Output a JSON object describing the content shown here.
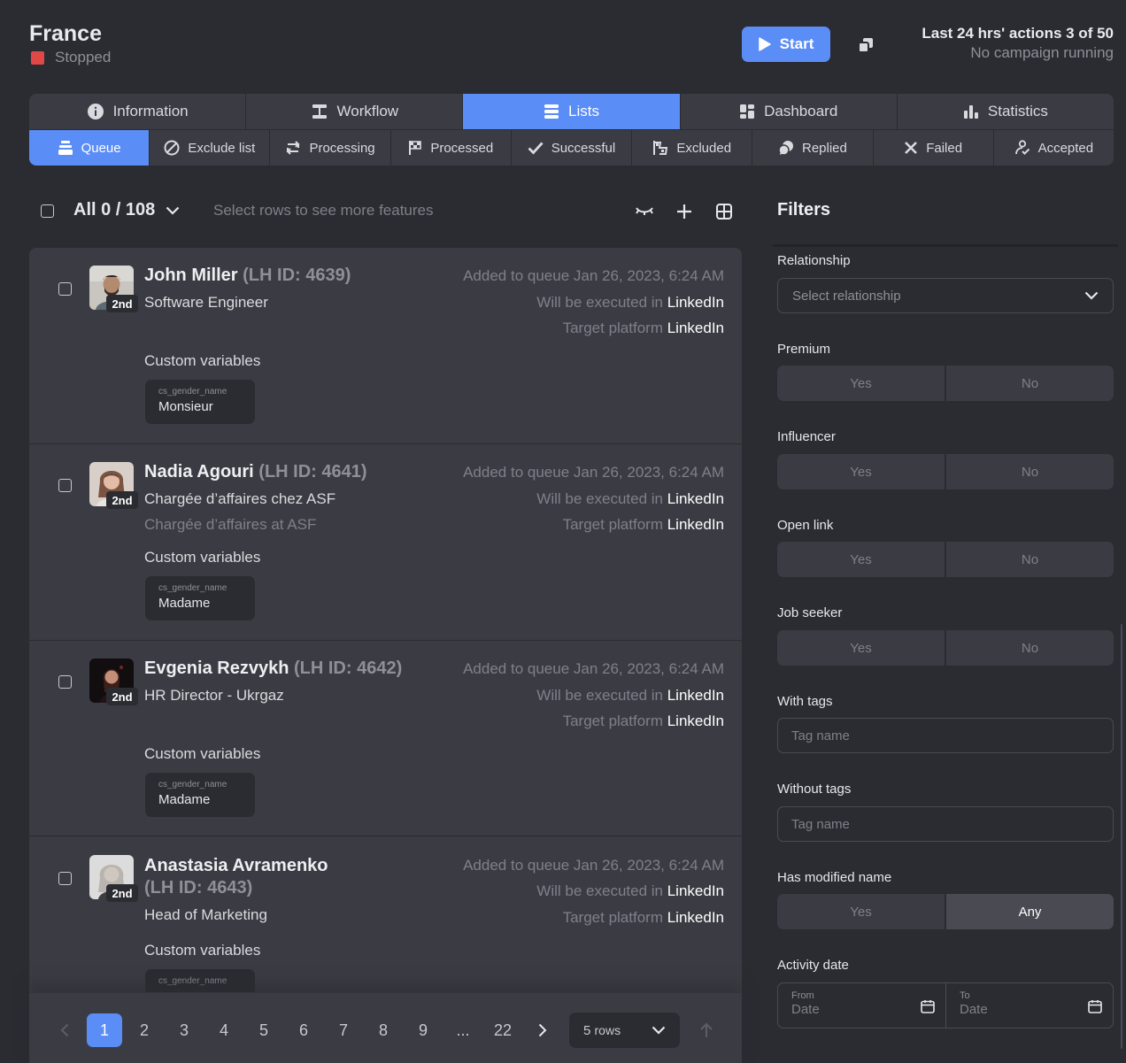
{
  "header": {
    "title": "France",
    "status": "Stopped",
    "start_label": "Start",
    "actions_line": "Last 24 hrs' actions 3 of 50",
    "campaign_line": "No campaign running"
  },
  "main_tabs": [
    {
      "label": "Information"
    },
    {
      "label": "Workflow"
    },
    {
      "label": "Lists"
    },
    {
      "label": "Dashboard"
    },
    {
      "label": "Statistics"
    }
  ],
  "sub_tabs": [
    {
      "label": "Queue"
    },
    {
      "label": "Exclude list"
    },
    {
      "label": "Processing"
    },
    {
      "label": "Processed"
    },
    {
      "label": "Successful"
    },
    {
      "label": "Excluded"
    },
    {
      "label": "Replied"
    },
    {
      "label": "Failed"
    },
    {
      "label": "Accepted"
    }
  ],
  "toolbar": {
    "all_count": "All 0 / 108",
    "hint": "Select rows to see more features"
  },
  "items": [
    {
      "name": "John Miller",
      "lh_id": "(LH ID: 4639)",
      "degree": "2nd",
      "headline": "Software Engineer",
      "headline_translated": "",
      "added": "Added to queue Jan 26, 2023, 6:24 AM",
      "executed_label": "Will be executed in",
      "executed_value": "LinkedIn",
      "platform_label": "Target platform",
      "platform_value": "LinkedIn",
      "cv_label": "Custom variables",
      "cv_key": "cs_gender_name",
      "cv_value": "Monsieur"
    },
    {
      "name": "Nadia Agouri",
      "lh_id": "(LH ID: 4641)",
      "degree": "2nd",
      "headline": "Chargée d’affaires chez ASF",
      "headline_translated": "Chargée d’affaires at ASF",
      "added": "Added to queue Jan 26, 2023, 6:24 AM",
      "executed_label": "Will be executed in",
      "executed_value": "LinkedIn",
      "platform_label": "Target platform",
      "platform_value": "LinkedIn",
      "cv_label": "Custom variables",
      "cv_key": "cs_gender_name",
      "cv_value": "Madame"
    },
    {
      "name": "Evgenia Rezvykh",
      "lh_id": "(LH ID: 4642)",
      "degree": "2nd",
      "headline": "HR Director - Ukrgaz",
      "headline_translated": "",
      "added": "Added to queue Jan 26, 2023, 6:24 AM",
      "executed_label": "Will be executed in",
      "executed_value": "LinkedIn",
      "platform_label": "Target platform",
      "platform_value": "LinkedIn",
      "cv_label": "Custom variables",
      "cv_key": "cs_gender_name",
      "cv_value": "Madame"
    },
    {
      "name": "Anastasia Avramenko",
      "lh_id": "(LH ID: 4643)",
      "degree": "2nd",
      "headline": "Head of Marketing",
      "headline_translated": "",
      "added": "Added to queue Jan 26, 2023, 6:24 AM",
      "executed_label": "Will be executed in",
      "executed_value": "LinkedIn",
      "platform_label": "Target platform",
      "platform_value": "LinkedIn",
      "cv_label": "Custom variables",
      "cv_key": "cs_gender_name",
      "cv_value": ""
    }
  ],
  "pagination": {
    "pages": [
      "1",
      "2",
      "3",
      "4",
      "5",
      "6",
      "7",
      "8",
      "9",
      "...",
      "22"
    ],
    "current": "1",
    "rows_value": "5",
    "rows_unit": "rows"
  },
  "filters": {
    "title": "Filters",
    "relationship_label": "Relationship",
    "relationship_placeholder": "Select relationship",
    "premium_label": "Premium",
    "influencer_label": "Influencer",
    "open_link_label": "Open link",
    "job_seeker_label": "Job seeker",
    "with_tags_label": "With tags",
    "without_tags_label": "Without tags",
    "tag_placeholder": "Tag name",
    "modified_name_label": "Has modified name",
    "yes": "Yes",
    "no": "No",
    "any": "Any",
    "activity_date_label": "Activity date",
    "from_label": "From",
    "to_label": "To",
    "date_placeholder": "Date"
  },
  "colors": {
    "accent": "#5b8df6",
    "background": "#2b2c32",
    "panel": "#3b3c43",
    "stopped": "#e04848"
  }
}
